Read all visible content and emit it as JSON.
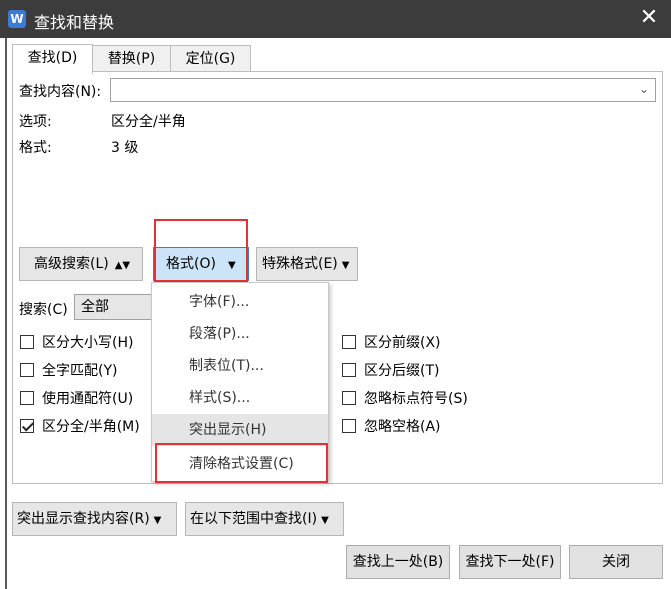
{
  "window": {
    "title": "查找和替换",
    "app_icon": "W",
    "close": "✕"
  },
  "tabs": [
    {
      "label": "查找(D)"
    },
    {
      "label": "替换(P)"
    },
    {
      "label": "定位(G)"
    }
  ],
  "find": {
    "label": "查找内容(N):",
    "value": ""
  },
  "options": {
    "label": "选项:",
    "value": "区分全/半角"
  },
  "format": {
    "label": "格式:",
    "value": "3 级"
  },
  "buttons": {
    "advanced": "高级搜索(L)",
    "format": "格式(O)",
    "special": "特殊格式(E)"
  },
  "search": {
    "label": "搜索(C)",
    "value": "全部"
  },
  "checkboxes_left": [
    {
      "label": "区分大小写(H)",
      "checked": false
    },
    {
      "label": "全字匹配(Y)",
      "checked": false
    },
    {
      "label": "使用通配符(U)",
      "checked": false
    },
    {
      "label": "区分全/半角(M)",
      "checked": true
    }
  ],
  "checkboxes_right": [
    {
      "label": "区分前缀(X)",
      "checked": false
    },
    {
      "label": "区分后缀(T)",
      "checked": false
    },
    {
      "label": "忽略标点符号(S)",
      "checked": false
    },
    {
      "label": "忽略空格(A)",
      "checked": false
    }
  ],
  "format_menu": [
    {
      "label": "字体(F)..."
    },
    {
      "label": "段落(P)..."
    },
    {
      "label": "制表位(T)..."
    },
    {
      "label": "样式(S)..."
    },
    {
      "label": "突出显示(H)"
    },
    {
      "label": "清除格式设置(C)"
    }
  ],
  "bottom": {
    "highlight": "突出显示查找内容(R)",
    "find_in": "在以下范围中查找(I)",
    "find_prev": "查找上一处(B)",
    "find_next": "查找下一处(F)",
    "close": "关闭"
  },
  "colors": {
    "titlebar": "#3c3c3c",
    "highlight_box": "#e03333",
    "pressed_button": "#cce4f7"
  }
}
